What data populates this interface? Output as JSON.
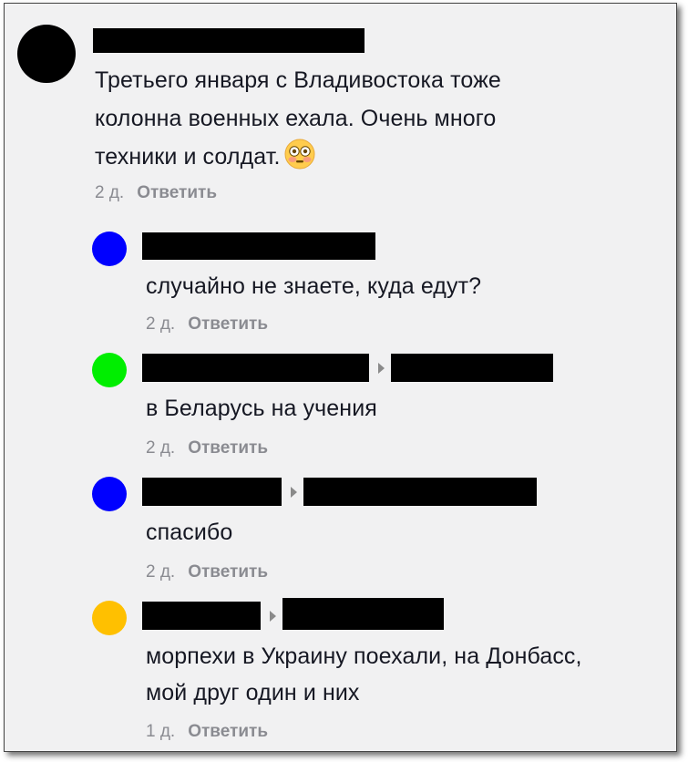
{
  "comments": [
    {
      "avatar_color": "#000000",
      "text_lines": [
        "Третьего января с Владивостока тоже",
        "колонна военных ехала. Очень много",
        "техники и солдат."
      ],
      "emoji": "flushed-face-emoji",
      "time": "2 д.",
      "reply_label": "Ответить"
    },
    {
      "avatar_color": "#0000ff",
      "text_lines": [
        "случайно не знаете, куда едут?"
      ],
      "time": "2 д.",
      "reply_label": "Ответить"
    },
    {
      "avatar_color": "#00ee00",
      "text_lines": [
        "в Беларусь на учения"
      ],
      "time": "2 д.",
      "reply_label": "Ответить"
    },
    {
      "avatar_color": "#0000ff",
      "text_lines": [
        "спасибо"
      ],
      "time": "2 д.",
      "reply_label": "Ответить"
    },
    {
      "avatar_color": "#ffc000",
      "text_lines": [
        "морпехи в Украину поехали, на Донбасс,",
        "мой друг один и них"
      ],
      "time": "1 д.",
      "reply_label": "Ответить"
    }
  ],
  "icons": {
    "reply_arrow": "caret-right-icon"
  }
}
